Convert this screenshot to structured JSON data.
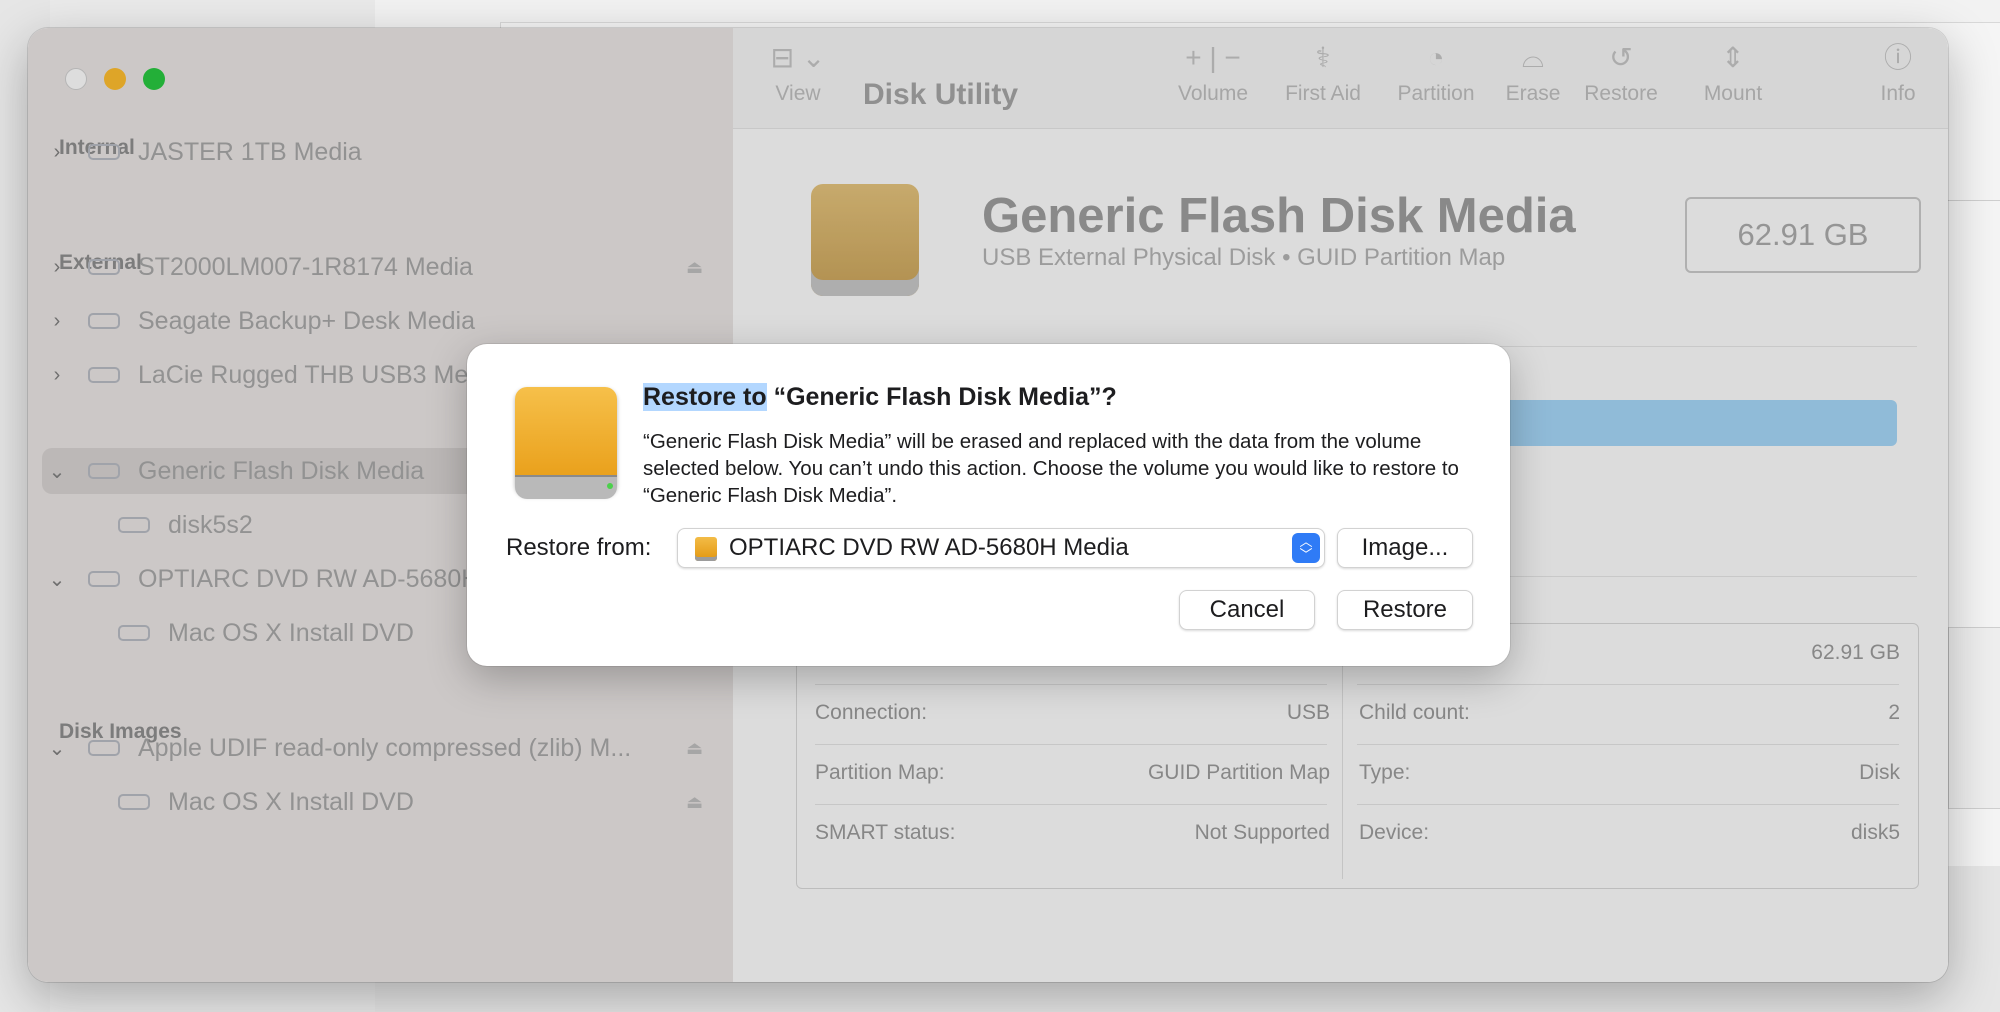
{
  "window": {
    "app_title": "Disk Utility"
  },
  "toolbar": {
    "view_label": "View",
    "volume_label": "Volume",
    "first_aid_label": "First Aid",
    "partition_label": "Partition",
    "erase_label": "Erase",
    "restore_label": "Restore",
    "mount_label": "Mount",
    "info_label": "Info",
    "view_glyph": "⊟ ⌄",
    "volume_glyph": "+ | −",
    "first_aid_glyph": "⚕",
    "partition_glyph": "◔",
    "erase_glyph": "⌓",
    "restore_glyph": "↺",
    "mount_glyph": "⇕",
    "info_glyph": "ⓘ"
  },
  "sidebar": {
    "sections": {
      "internal": "Internal",
      "external": "External",
      "disk_images": "Disk Images"
    },
    "items": [
      {
        "label": "JASTER 1TB Media"
      },
      {
        "label": "ST2000LM007-1R8174 Media"
      },
      {
        "label": "Seagate Backup+ Desk Media"
      },
      {
        "label": "LaCie Rugged THB USB3 Media"
      },
      {
        "label": "Generic Flash Disk Media"
      },
      {
        "label": "disk5s2"
      },
      {
        "label": "OPTIARC DVD RW AD-5680H Media"
      },
      {
        "label": "Mac OS X Install DVD"
      },
      {
        "label": "Apple UDIF read-only compressed (zlib) M..."
      },
      {
        "label": "Mac OS X Install DVD"
      }
    ]
  },
  "main": {
    "disk_name": "Generic Flash Disk Media",
    "disk_subtitle": "USB External Physical Disk • GUID Partition Map",
    "capacity": "62.91 GB",
    "info": {
      "capacity_value": "62.91 GB",
      "connection_label": "Connection:",
      "connection_value": "USB",
      "partition_map_label": "Partition Map:",
      "partition_map_value": "GUID Partition Map",
      "smart_label": "SMART status:",
      "smart_value": "Not Supported",
      "child_count_label": "Child count:",
      "child_count_value": "2",
      "type_label": "Type:",
      "type_value": "Disk",
      "device_label": "Device:",
      "device_value": "disk5"
    }
  },
  "dialog": {
    "title_highlight": "Restore to",
    "title_rest": " “Generic Flash Disk Media”?",
    "message": "“Generic Flash Disk Media” will be erased and replaced with the data from the volume selected below. You can’t undo this action. Choose the volume you would like to restore to “Generic Flash Disk Media”.",
    "restore_from_label": "Restore from:",
    "restore_from_value": "OPTIARC DVD RW AD-5680H Media",
    "image_button": "Image...",
    "cancel_button": "Cancel",
    "restore_button": "Restore",
    "accent_color": "#2f7bf6"
  }
}
